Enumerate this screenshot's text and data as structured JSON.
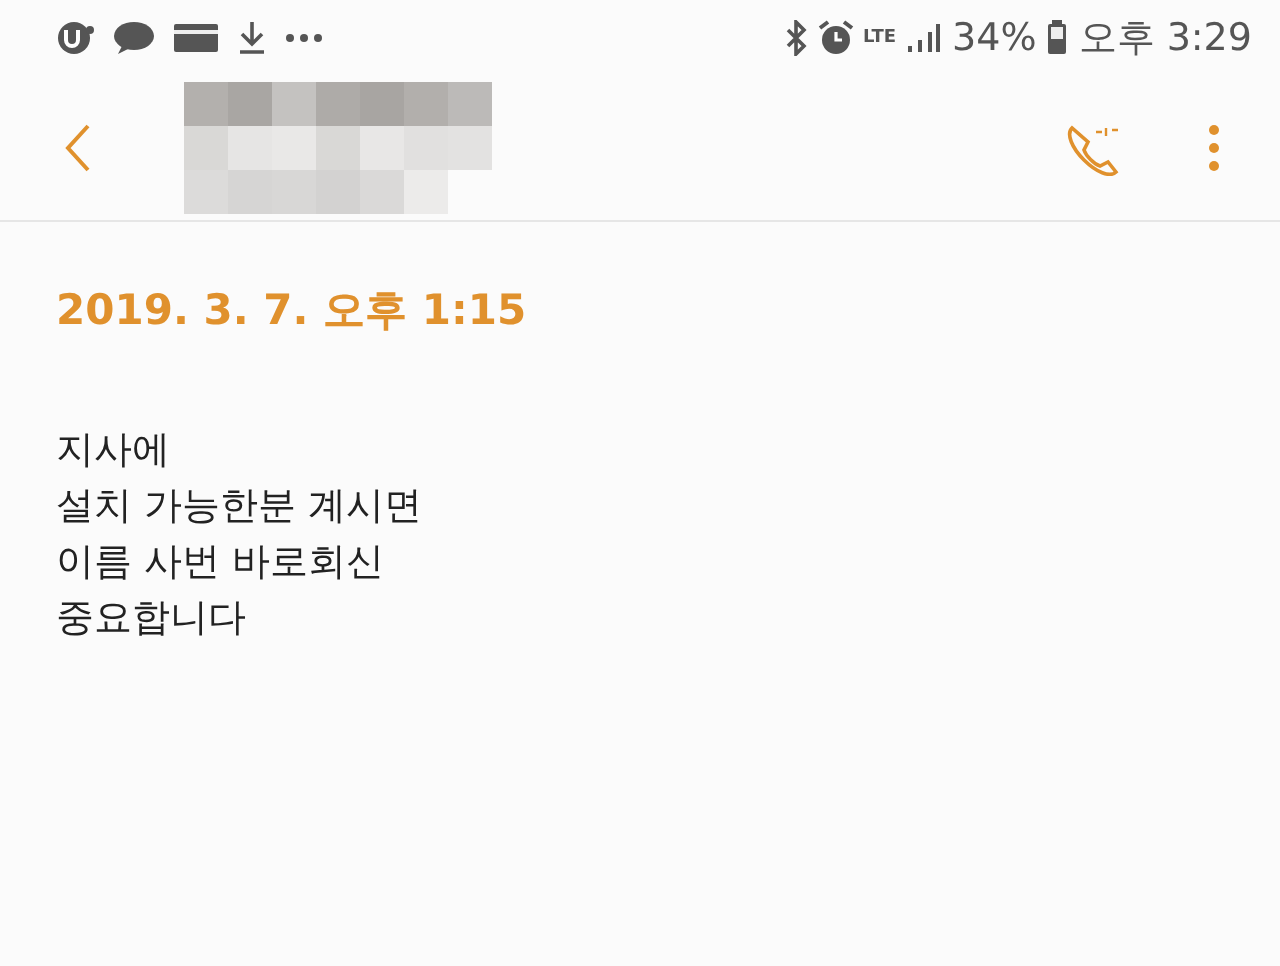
{
  "status_bar": {
    "network": "LTE",
    "battery": "34%",
    "time": "오후 3:29"
  },
  "message": {
    "date": "2019. 3. 7.  오후 1:15",
    "body": "지사에\n설치 가능한분 계시면\n이름 사번 바로회신\n중요합니다"
  }
}
